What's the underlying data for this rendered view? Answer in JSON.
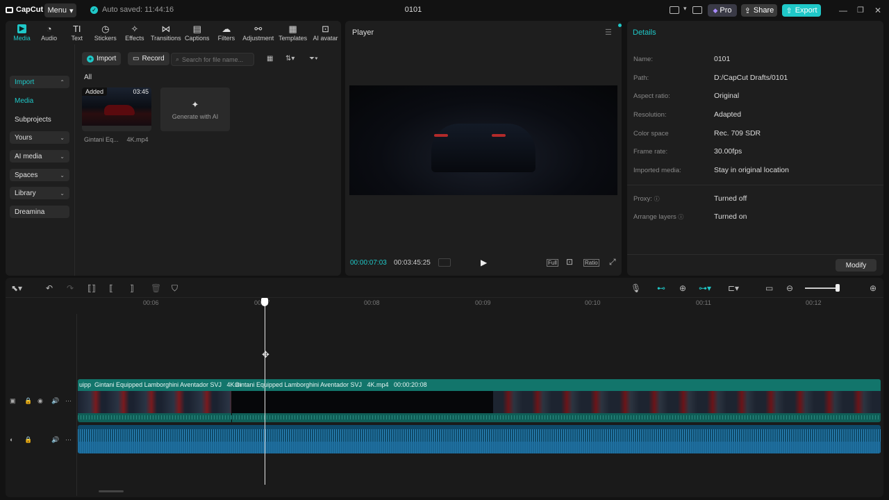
{
  "app": {
    "logo": "CapCut",
    "menu_label": "Menu",
    "autosave": "Auto saved: 11:44:16",
    "project_title": "0101",
    "pro_label": "Pro",
    "share_label": "Share",
    "export_label": "Export",
    "accent": "#1fc8c8"
  },
  "toolbar": {
    "tabs": [
      {
        "label": "Media",
        "icon": "media-icon"
      },
      {
        "label": "Audio",
        "icon": "audio-icon"
      },
      {
        "label": "Text",
        "icon": "text-icon"
      },
      {
        "label": "Stickers",
        "icon": "stickers-icon"
      },
      {
        "label": "Effects",
        "icon": "effects-icon"
      },
      {
        "label": "Transitions",
        "icon": "transitions-icon"
      },
      {
        "label": "Captions",
        "icon": "captions-icon"
      },
      {
        "label": "Filters",
        "icon": "filters-icon"
      },
      {
        "label": "Adjustment",
        "icon": "adjustment-icon"
      },
      {
        "label": "Templates",
        "icon": "templates-icon"
      },
      {
        "label": "AI avatar",
        "icon": "ai-avatar-icon"
      }
    ]
  },
  "sidebar": {
    "items": [
      {
        "label": "Import"
      },
      {
        "label": "Media"
      },
      {
        "label": "Subprojects"
      },
      {
        "label": "Yours"
      },
      {
        "label": "AI media"
      },
      {
        "label": "Spaces"
      },
      {
        "label": "Library"
      },
      {
        "label": "Dreamina"
      }
    ]
  },
  "media": {
    "import_label": "Import",
    "record_label": "Record",
    "search_placeholder": "Search for file name...",
    "filter_label": "All",
    "items": [
      {
        "badge": "Added",
        "duration": "03:45",
        "name_a": "Gintani Eq...",
        "name_b": "4K.mp4"
      }
    ],
    "generate_label": "Generate with AI"
  },
  "player": {
    "title": "Player",
    "current_time": "00:00:07:03",
    "total_time": "00:03:45:25",
    "full_label": "Full",
    "ratio_label": "Ratio"
  },
  "details": {
    "title": "Details",
    "rows": [
      {
        "label": "Name:",
        "value": "0101"
      },
      {
        "label": "Path:",
        "value": "D:/CapCut Drafts/0101"
      },
      {
        "label": "Aspect ratio:",
        "value": "Original"
      },
      {
        "label": "Resolution:",
        "value": "Adapted"
      },
      {
        "label": "Color space",
        "value": "Rec. 709 SDR"
      },
      {
        "label": "Frame rate:",
        "value": "30.00fps"
      },
      {
        "label": "Imported media:",
        "value": "Stay in original location"
      },
      {
        "label": "Proxy:",
        "value": "Turned off"
      },
      {
        "label": "Arrange layers",
        "value": "Turned on"
      }
    ],
    "modify_label": "Modify"
  },
  "timeline": {
    "ruler": [
      "00:06",
      "00:07",
      "00:08",
      "00:09",
      "00:10",
      "00:11",
      "00:12"
    ],
    "clip1_label_a": "uipp",
    "clip1_label_b": "Gintani Equipped Lamborghini Aventador SVJ",
    "clip1_label_c": "4K.m",
    "clip2_label": "Gintani Equipped Lamborghini Aventador SVJ",
    "clip2_file": "4K.mp4",
    "clip2_duration": "00:00:20:08"
  }
}
